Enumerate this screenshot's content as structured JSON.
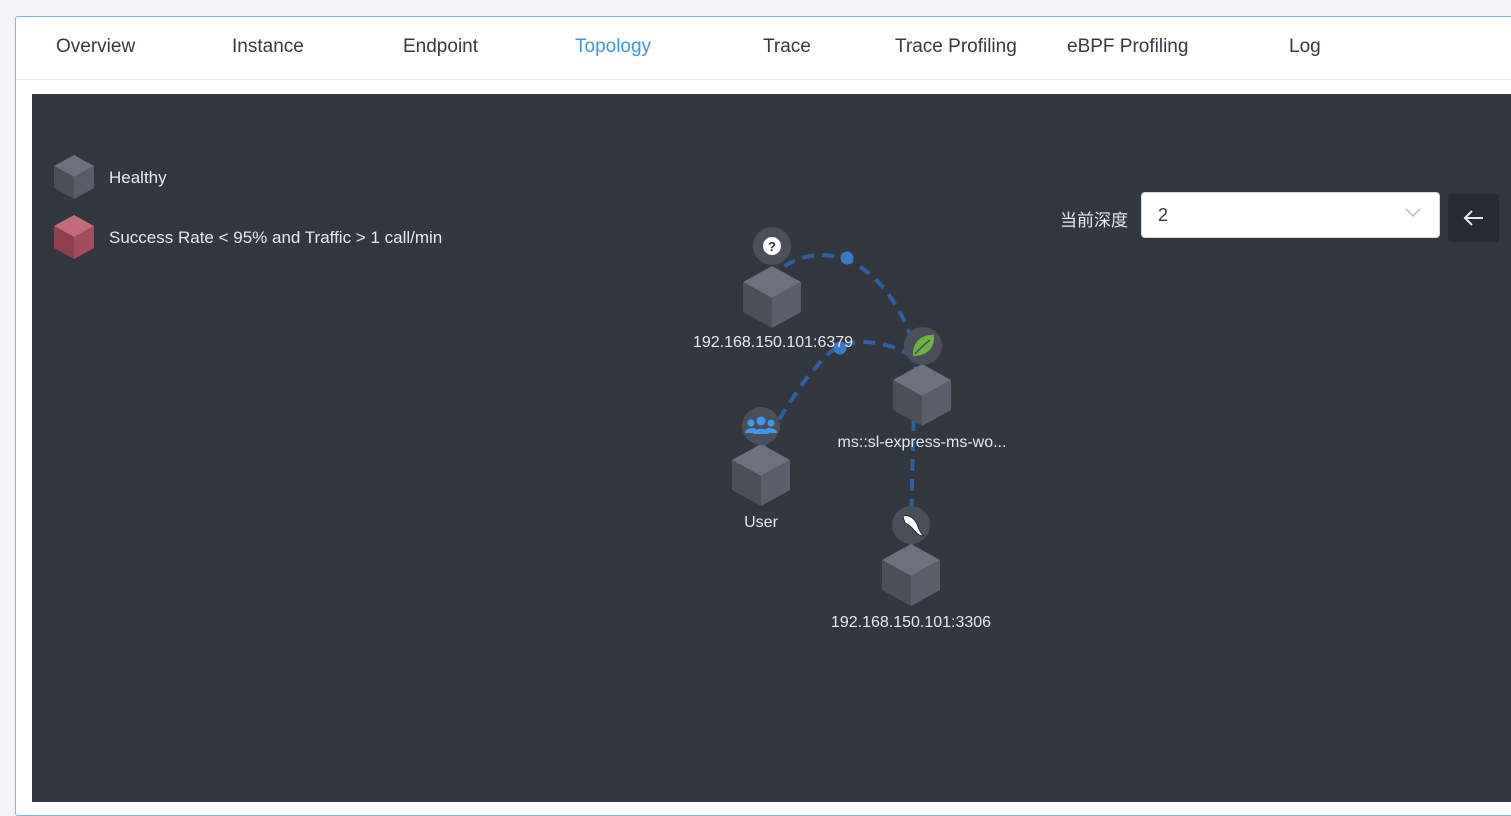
{
  "tabs": [
    {
      "label": "Overview"
    },
    {
      "label": "Instance"
    },
    {
      "label": "Endpoint"
    },
    {
      "label": "Topology",
      "active": true
    },
    {
      "label": "Trace"
    },
    {
      "label": "Trace Profiling"
    },
    {
      "label": "eBPF Profiling"
    },
    {
      "label": "Log"
    }
  ],
  "legend": {
    "healthy": {
      "label": "Healthy",
      "color": "#5b606d"
    },
    "unhealthy": {
      "label": "Success Rate < 95% and Traffic > 1 call/min",
      "color": "#b25467"
    }
  },
  "depth": {
    "label": "当前深度",
    "value": "2"
  },
  "topology": {
    "nodes": [
      {
        "id": "redis",
        "label": "192.168.150.101:6379",
        "icon": "question-icon"
      },
      {
        "id": "service",
        "label": "ms::sl-express-ms-wo...",
        "icon": "spring-leaf-icon"
      },
      {
        "id": "user",
        "label": "User",
        "icon": "users-icon"
      },
      {
        "id": "mysql",
        "label": "192.168.150.101:3306",
        "icon": "mysql-dolphin-icon"
      }
    ]
  },
  "colors": {
    "accent": "#3f95ea",
    "canvas_bg": "#333740",
    "edge": "#2f5fa0",
    "edge_dot": "#3a78c8"
  }
}
